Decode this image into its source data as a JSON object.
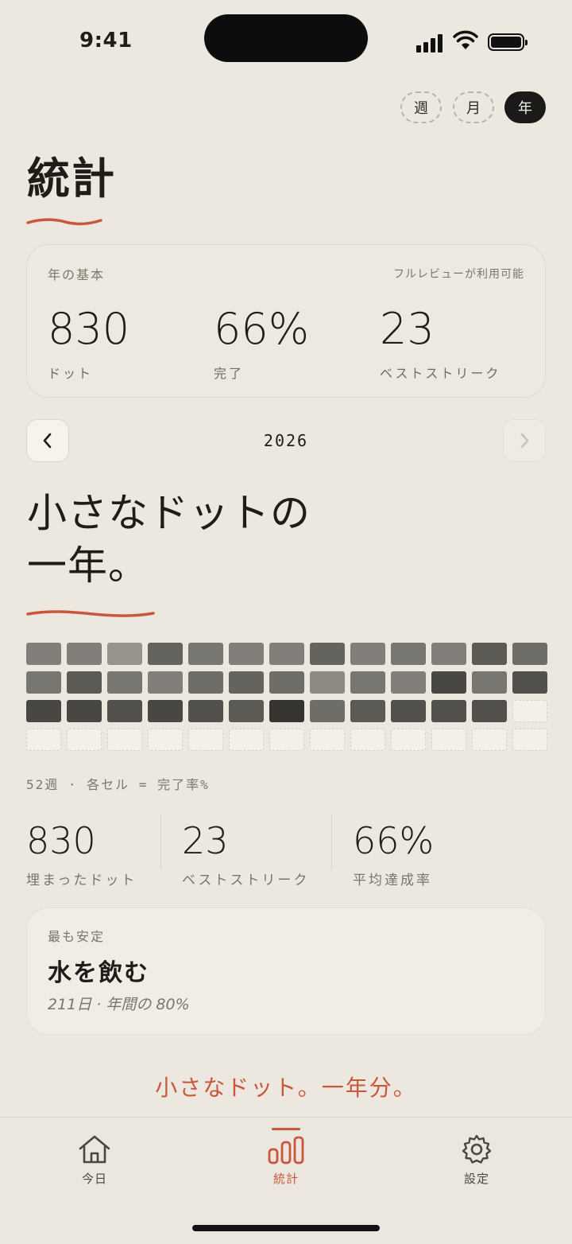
{
  "status_bar": {
    "time": "9:41"
  },
  "period_toggle": {
    "week": "週",
    "month": "月",
    "year": "年",
    "selected": "年"
  },
  "page_title": "統計",
  "summary_card": {
    "label": "年の基本",
    "note": "フルレビューが利用可能",
    "stats": [
      {
        "value": "830",
        "label": "ドット"
      },
      {
        "value": "66%",
        "label": "完了"
      },
      {
        "value": "23",
        "label": "ベストストリーク"
      }
    ]
  },
  "year_nav": {
    "year": "2026"
  },
  "headline": {
    "line1": "小さなドットの",
    "line2": "一年。"
  },
  "heatmap": {
    "caption": "52週 · 各セル = 完了率%",
    "rows": [
      [
        0.55,
        0.55,
        0.45,
        0.7,
        0.6,
        0.55,
        0.55,
        0.7,
        0.55,
        0.6,
        0.55,
        0.75,
        0.65
      ],
      [
        0.6,
        0.75,
        0.6,
        0.55,
        0.65,
        0.7,
        0.65,
        0.5,
        0.6,
        0.55,
        0.85,
        0.6,
        0.8
      ],
      [
        0.85,
        0.85,
        0.8,
        0.85,
        0.8,
        0.75,
        0.95,
        0.65,
        0.75,
        0.8,
        0.8,
        0.8,
        null
      ],
      [
        null,
        null,
        null,
        null,
        null,
        null,
        null,
        null,
        null,
        null,
        null,
        null,
        null
      ]
    ],
    "colors": {
      "ink": "#2b2a27",
      "paper": "#ece8df",
      "empty": "#f3f0e9"
    }
  },
  "bottom_stats": [
    {
      "value": "830",
      "label": "埋まったドット"
    },
    {
      "value": "23",
      "label": "ベストストリーク"
    },
    {
      "value": "66%",
      "label": "平均達成率"
    }
  ],
  "highlight_card": {
    "label": "最も安定",
    "habit": "水を飲む",
    "meta": "211日 · 年間の 80%"
  },
  "footer_quote": "小さなドット。一年分。",
  "tab_bar": {
    "items": [
      {
        "label": "今日",
        "icon": "house-icon"
      },
      {
        "label": "統計",
        "icon": "bar-chart-icon",
        "active": true
      },
      {
        "label": "設定",
        "icon": "gear-icon"
      }
    ]
  },
  "accent_color": "#c9573c"
}
